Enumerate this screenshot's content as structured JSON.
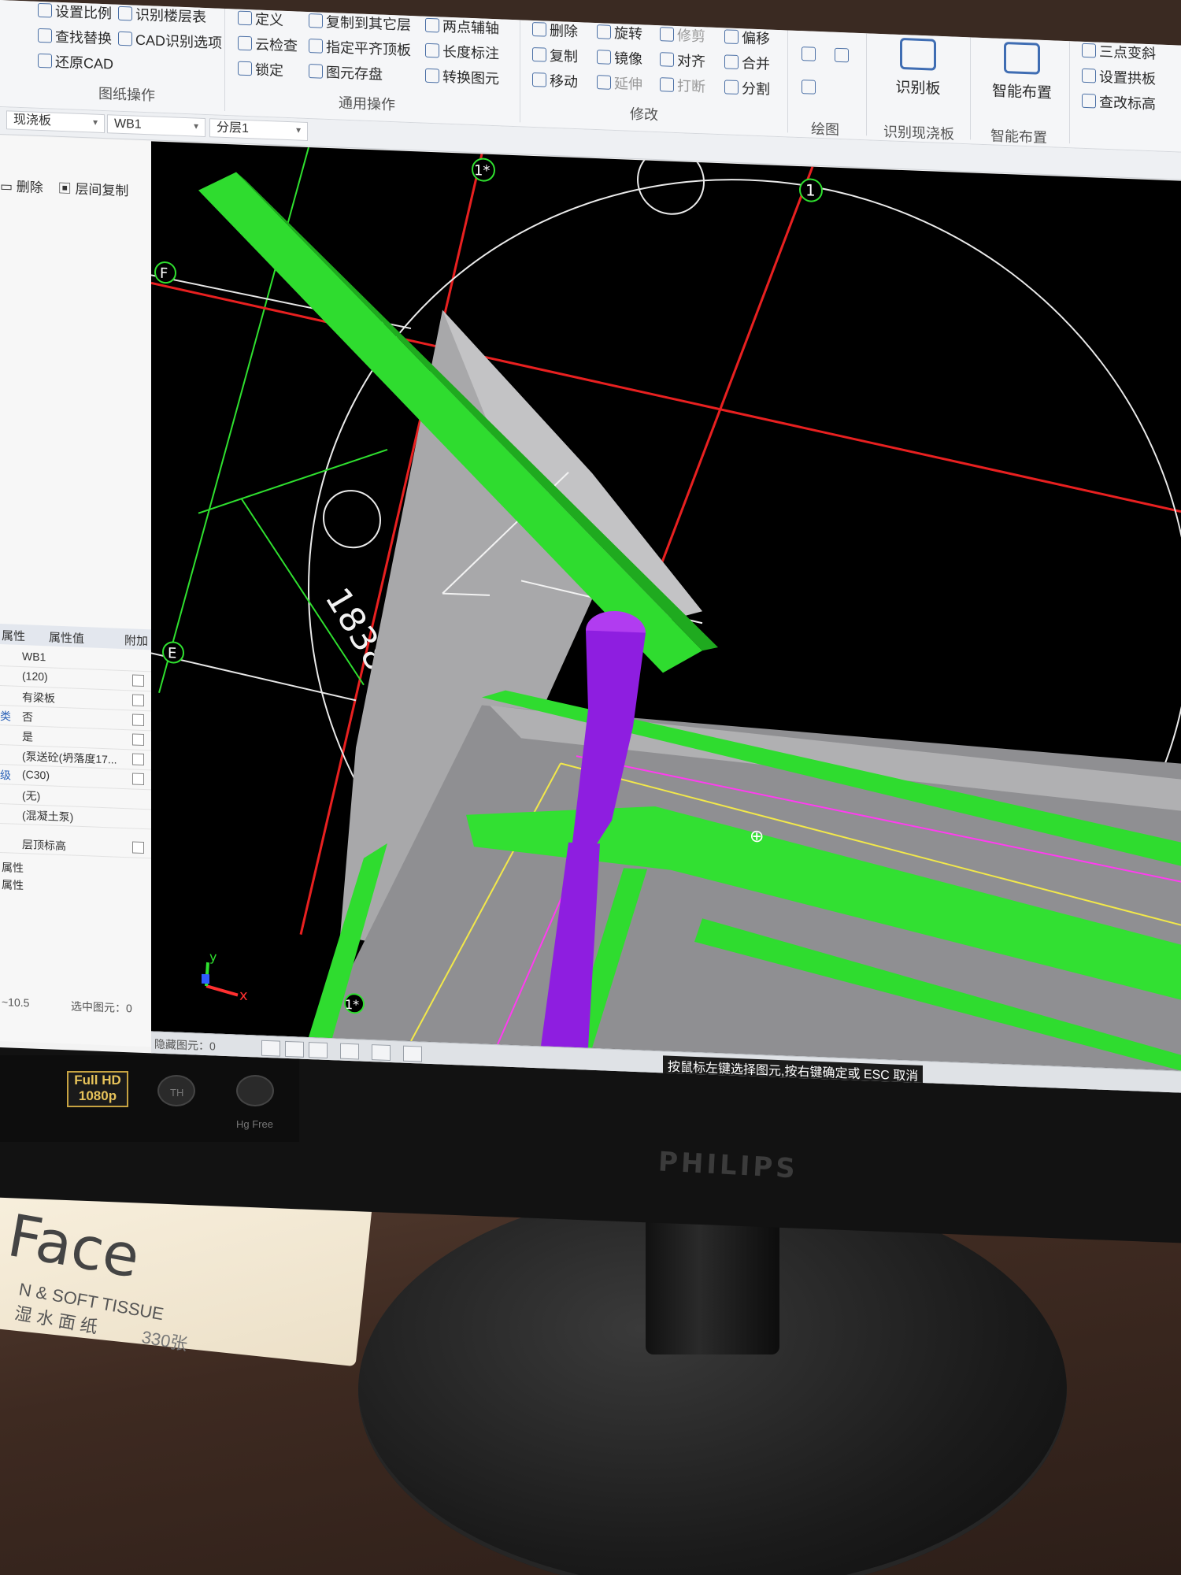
{
  "ribbon": {
    "buttons": [
      {
        "label": "设置比例"
      },
      {
        "label": "查找替换"
      },
      {
        "label": "还原CAD"
      },
      {
        "label": "识别楼层表"
      },
      {
        "label": "CAD识别选项"
      },
      {
        "label": "定义"
      },
      {
        "label": "云检查"
      },
      {
        "label": "锁定"
      },
      {
        "label": "复制到其它层"
      },
      {
        "label": "指定平齐顶板"
      },
      {
        "label": "图元存盘"
      },
      {
        "label": "两点辅轴"
      },
      {
        "label": "长度标注"
      },
      {
        "label": "转换图元"
      },
      {
        "label": "删除"
      },
      {
        "label": "复制"
      },
      {
        "label": "移动"
      },
      {
        "label": "旋转"
      },
      {
        "label": "镜像"
      },
      {
        "label": "延伸"
      },
      {
        "label": "修剪"
      },
      {
        "label": "对齐"
      },
      {
        "label": "打断"
      },
      {
        "label": "偏移"
      },
      {
        "label": "合并"
      },
      {
        "label": "分割"
      },
      {
        "label": "识别板"
      },
      {
        "label": "智能布置"
      },
      {
        "label": "三点变斜"
      },
      {
        "label": "设置拱板"
      },
      {
        "label": "查改标高"
      }
    ],
    "groups": [
      "图纸操作",
      "通用操作",
      "修改",
      "绘图",
      "识别现浇板",
      "智能布置"
    ]
  },
  "selectors": {
    "type": "现浇板",
    "name": "WB1",
    "layer": "分层1"
  },
  "left_panel": {
    "tools": [
      "删除",
      "层间复制"
    ],
    "title": "属性",
    "headers": [
      "属性值",
      "附加"
    ],
    "rows": [
      "WB1",
      "(120)",
      "有梁板",
      "否",
      "是",
      "(泵送砼(坍落度17...",
      "(C30)",
      "(无)",
      "(混凝土泵)",
      "层顶标高"
    ],
    "row_labels": [
      "",
      "",
      "",
      "类",
      "",
      "",
      "级",
      "",
      "",
      ""
    ],
    "footer_labels": [
      "属性",
      "属性"
    ],
    "status_left": "~10.5",
    "status_sel": "选中图元：0",
    "status_hidden": "隐藏图元：0"
  },
  "viewport": {
    "axis_labels": [
      "1*",
      "1",
      "F",
      "E",
      "1*"
    ],
    "dimension": "1838",
    "ucs_x": "x",
    "ucs_y": "y",
    "hint": "按鼠标左键选择图元,按右键确定或 ESC 取消"
  },
  "monitor": {
    "brand": "PHILIPS",
    "osd_badge": "Full HD 1080p",
    "osd_labels": [
      "TH",
      "Hg Free"
    ]
  },
  "tissue": {
    "brand": "Face",
    "subtitle": "N & SOFT TISSUE",
    "subtitle_cn": "湿 水 面 纸",
    "count": "330张"
  }
}
